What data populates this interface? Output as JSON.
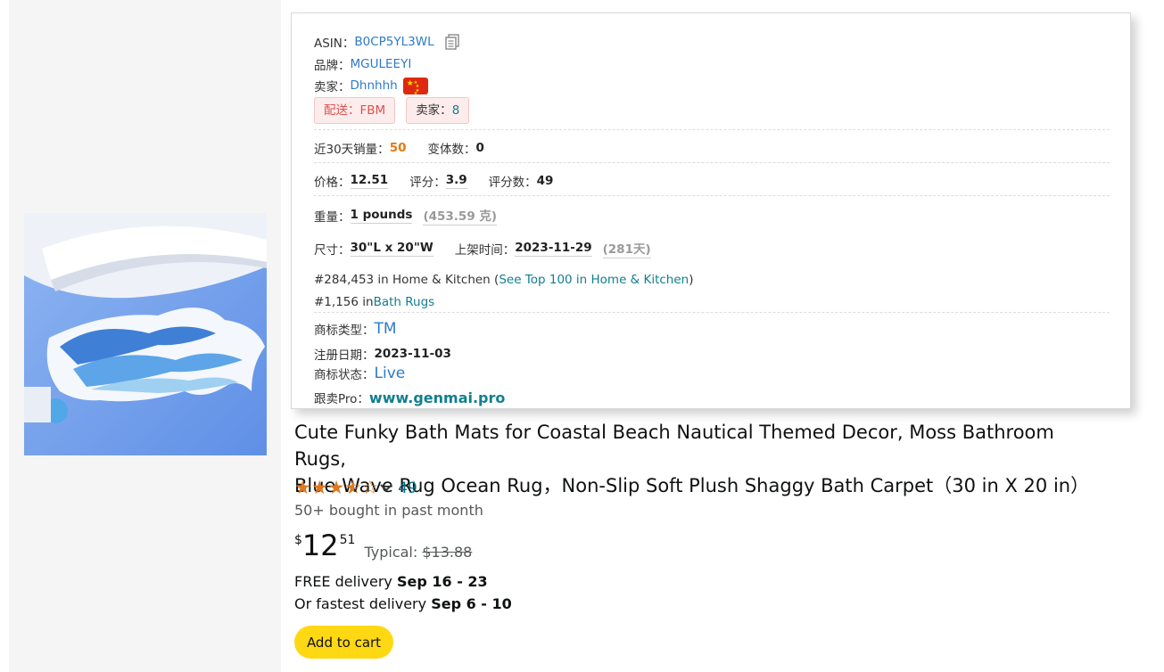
{
  "info": {
    "asin_label": "ASIN：",
    "asin": "B0CP5YL3WL",
    "brand_label": "品牌：",
    "brand": "MGULEEYI",
    "seller_label": "卖家：",
    "seller": "Dhnhhh",
    "tag_shipping": "配送：FBM",
    "tag_sellers_label": "卖家：",
    "tag_sellers_count": "8",
    "sales30_label": "近30天销量：",
    "sales30": "50",
    "variants_label": "变体数：",
    "variants": "0",
    "price_label": "价格：",
    "price": "12.51",
    "rating_label": "评分：",
    "rating": "3.9",
    "rating_count_label": "评分数：",
    "rating_count": "49",
    "weight_label": "重量：",
    "weight": "1 pounds",
    "weight_g": "(453.59 克)",
    "size_label": "尺寸：",
    "size": "30\"L x 20\"W",
    "listed_label": "上架时间：",
    "listed_date": "2023-11-29",
    "listed_days": "(281天)",
    "rank1_text": "#284,453 in Home & Kitchen (",
    "rank1_link": "See Top 100 in Home & Kitchen",
    "rank1_close": ")",
    "rank2_text": "#1,156 in ",
    "rank2_link": "Bath Rugs",
    "tm_type_label": "商标类型：",
    "tm_type": "TM",
    "reg_date_label": "注册日期：",
    "reg_date": "2023-11-03",
    "tm_status_label": "商标状态：",
    "tm_status": "Live",
    "genmai_label": "跟卖Pro：",
    "genmai_link": "www.genmai.pro"
  },
  "product": {
    "title_line1": "Cute Funky Bath Mats for Coastal Beach Nautical Themed Decor, Moss Bathroom Rugs,",
    "title_line2": "Blue Wave Rug Ocean Rug，Non-Slip Soft Plush Shaggy Bath Carpet（30 in X 20 in）",
    "rating_stars": 3.9,
    "rating_count": "49",
    "bought": "50+ bought in past month",
    "price_symbol": "$",
    "price_whole": "12",
    "price_fraction": "51",
    "typical_label": "Typical:",
    "typical_price": "$13.88",
    "delivery1_prefix": "FREE delivery ",
    "delivery1_date": "Sep 16 - 23",
    "delivery2_prefix": "Or fastest delivery ",
    "delivery2_date": "Sep 6 - 10",
    "add_to_cart": "Add to cart"
  },
  "colors": {
    "link_blue": "#2d7bc6",
    "link_teal": "#117f8f",
    "orange": "#e47911",
    "star": "#de7921",
    "cart_button": "#ffd814"
  }
}
